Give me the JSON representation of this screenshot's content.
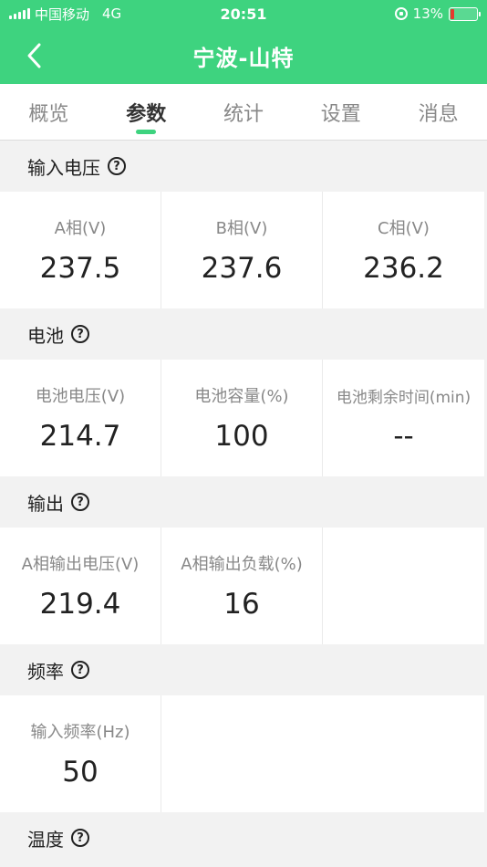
{
  "status_bar": {
    "carrier": "中国移动",
    "network": "4G",
    "time": "20:51",
    "battery": "13%",
    "battery_level": 0.13
  },
  "nav": {
    "title": "宁波-山特"
  },
  "tabs": [
    {
      "label": "概览",
      "active": false
    },
    {
      "label": "参数",
      "active": true
    },
    {
      "label": "统计",
      "active": false
    },
    {
      "label": "设置",
      "active": false
    },
    {
      "label": "消息",
      "active": false
    }
  ],
  "sections": {
    "input_voltage": {
      "title": "输入电压",
      "cells": [
        {
          "label": "A相(V)",
          "value": "237.5"
        },
        {
          "label": "B相(V)",
          "value": "237.6"
        },
        {
          "label": "C相(V)",
          "value": "236.2"
        }
      ]
    },
    "battery": {
      "title": "电池",
      "cells": [
        {
          "label": "电池电压(V)",
          "value": "214.7"
        },
        {
          "label": "电池容量(%)",
          "value": "100"
        },
        {
          "label": "电池剩余时间(min)",
          "value": "--"
        }
      ]
    },
    "output": {
      "title": "输出",
      "cells": [
        {
          "label": "A相输出电压(V)",
          "value": "219.4"
        },
        {
          "label": "A相输出负载(%)",
          "value": "16"
        }
      ]
    },
    "frequency": {
      "title": "频率",
      "cells": [
        {
          "label": "输入频率(Hz)",
          "value": "50"
        }
      ]
    },
    "temperature": {
      "title": "温度"
    }
  },
  "colors": {
    "brand": "#3ed37f",
    "battery_low": "#e63b2e"
  }
}
